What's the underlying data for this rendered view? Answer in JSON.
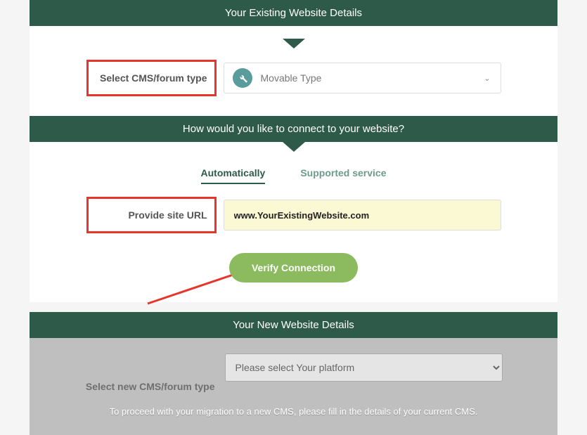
{
  "header1": {
    "title": "Your Existing Website Details"
  },
  "cms_row": {
    "label": "Select CMS/forum type",
    "value": "Movable Type"
  },
  "header2": {
    "title": "How would you like to connect to your website?"
  },
  "tabs": {
    "auto": "Automatically",
    "supported": "Supported service"
  },
  "url_row": {
    "label": "Provide site URL",
    "value": "www.YourExistingWebsite.com"
  },
  "buttons": {
    "verify": "Verify Connection"
  },
  "header3": {
    "title": "Your New Website Details"
  },
  "new_cms": {
    "label": "Select new CMS/forum type",
    "placeholder": "Please select Your platform"
  },
  "hint": "To proceed with your migration to a new CMS, please fill in the details of your current CMS."
}
